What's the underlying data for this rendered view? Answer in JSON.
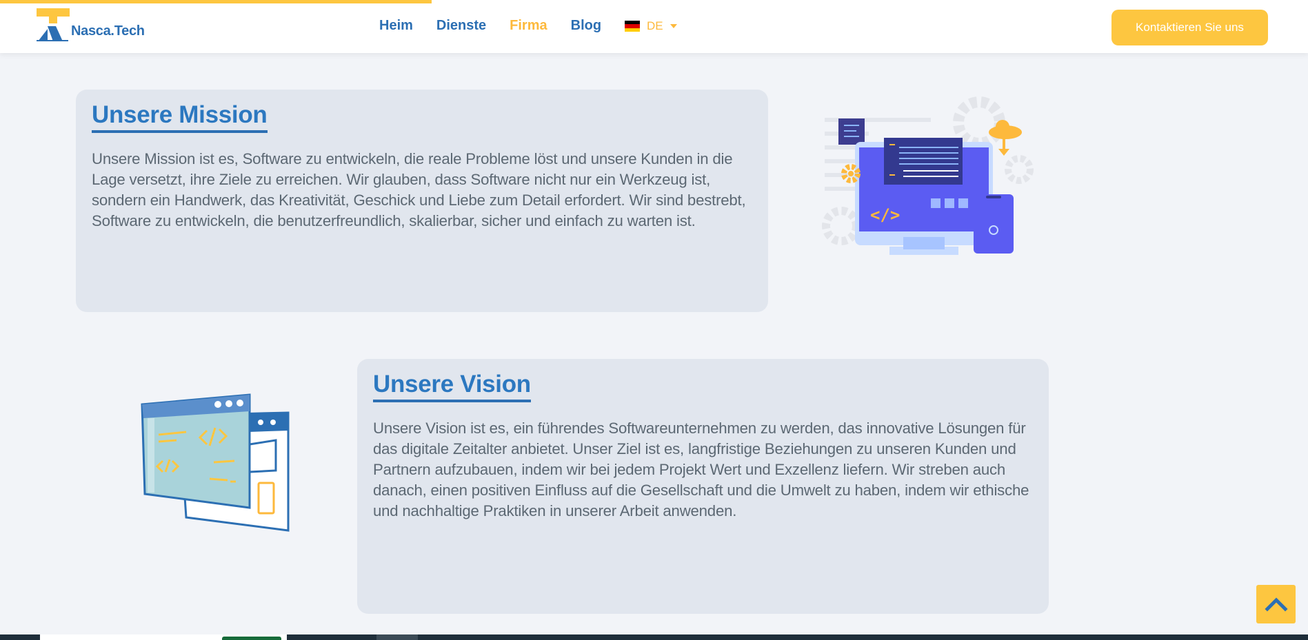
{
  "header": {
    "brand": "Nasca.Tech",
    "nav": [
      {
        "label": "Heim",
        "active": false
      },
      {
        "label": "Dienste",
        "active": false
      },
      {
        "label": "Firma",
        "active": true
      },
      {
        "label": "Blog",
        "active": false
      }
    ],
    "language": {
      "code": "DE",
      "flag_icon": "germany-flag-icon"
    },
    "cta_label": "Kontaktieren Sie uns",
    "scroll_progress": 0.33
  },
  "mission": {
    "title": "Unsere Mission",
    "text": "Unsere Mission ist es, Software zu entwickeln, die reale Probleme löst und unsere Kunden in die Lage versetzt, ihre Ziele zu erreichen. Wir glauben, dass Software nicht nur ein Werkzeug ist, sondern ein Handwerk, das Kreativität, Geschick und Liebe zum Detail erfordert. Wir sind bestrebt, Software zu entwickeln, die benutzerfreundlich, skalierbar, sicher und einfach zu warten ist."
  },
  "vision": {
    "title": "Unsere Vision",
    "text": "Unsere Vision ist es, ein führendes Softwareunternehmen zu werden, das innovative Lösungen für das digitale Zeitalter anbietet. Unser Ziel ist es, langfristige Beziehungen zu unseren Kunden und Partnern aufzubauen, indem wir bei jedem Projekt Wert und Exzellenz liefern. Wir streben auch danach, einen positiven Einfluss auf die Gesellschaft und die Umwelt zu haben, indem wir ethische und nachhaltige Praktiken in unserer Arbeit anwenden."
  },
  "colors": {
    "accent": "#fdc640",
    "brand_blue": "#2c6fb3",
    "card_bg": "#e1e6ee",
    "page_bg": "#f2f4f8"
  },
  "icons": {
    "scroll_top": "chevron-up-icon",
    "caret": "caret-down-icon"
  }
}
